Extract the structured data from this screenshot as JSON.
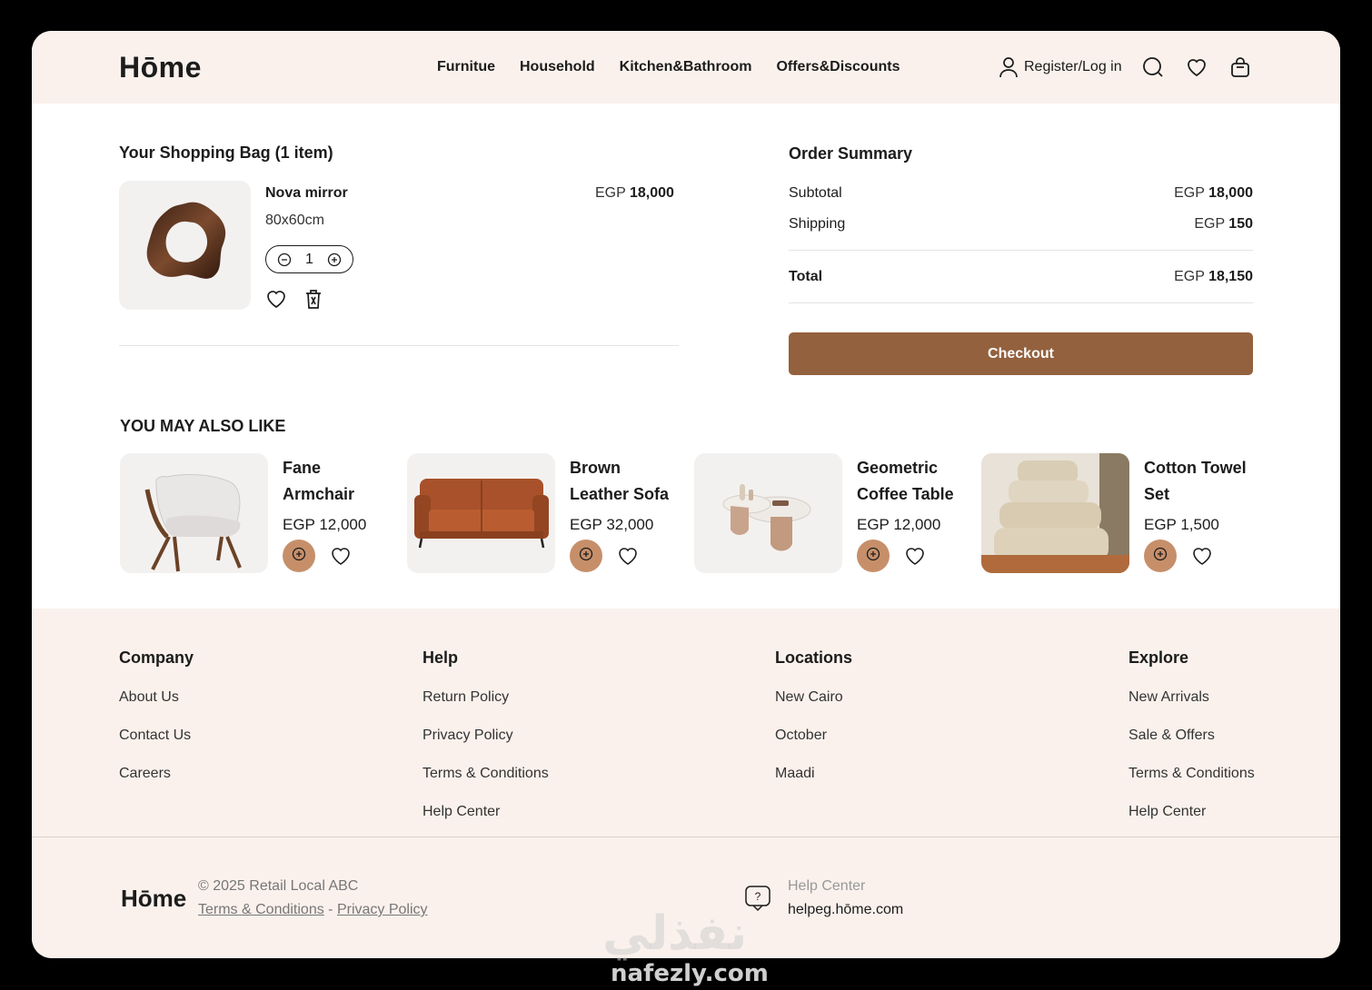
{
  "header": {
    "logo": "Hōme",
    "nav": [
      "Furnitue",
      "Household",
      "Kitchen&Bathroom",
      "Offers&Discounts"
    ],
    "register_label": "Register/Log in",
    "icons": [
      "user-icon",
      "search-icon",
      "heart-icon",
      "bag-icon"
    ]
  },
  "bag": {
    "title": "Your Shopping Bag (1 item)",
    "item": {
      "name": "Nova mirror",
      "size": "80x60cm",
      "currency": "EGP",
      "price": "18,000",
      "quantity": "1"
    }
  },
  "summary": {
    "title": "Order Summary",
    "subtotal_label": "Subtotal",
    "subtotal_currency": "EGP",
    "subtotal": "18,000",
    "shipping_label": "Shipping",
    "shipping_currency": "EGP",
    "shipping": "150",
    "total_label": "Total",
    "total_currency": "EGP",
    "total": "18,150",
    "checkout_label": "Checkout"
  },
  "also_like": {
    "title": "YOU MAY ALSO LIKE",
    "products": [
      {
        "name": "Fane Armchair",
        "price": "EGP 12,000"
      },
      {
        "name": "Brown Leather Sofa",
        "price": "EGP 32,000"
      },
      {
        "name": "Geometric Coffee Table",
        "price": "EGP 12,000"
      },
      {
        "name": "Cotton Towel Set",
        "price": "EGP 1,500"
      }
    ]
  },
  "footer": {
    "columns": [
      {
        "title": "Company",
        "links": [
          "About Us",
          "Contact Us",
          "Careers"
        ]
      },
      {
        "title": "Help",
        "links": [
          "Return Policy",
          "Privacy Policy",
          "Terms & Conditions",
          "Help Center"
        ]
      },
      {
        "title": "Locations",
        "links": [
          "New Cairo",
          "October",
          "Maadi"
        ]
      },
      {
        "title": "Explore",
        "links": [
          "New Arrivals",
          "Sale & Offers",
          "Terms & Conditions",
          "Help Center"
        ]
      }
    ],
    "logo": "Hōme",
    "copyright": "© 2025 Retail Local ABC",
    "terms_link": "Terms & Conditions",
    "separator": "-",
    "privacy_link": "Privacy Policy",
    "help_label": "Help Center",
    "help_email": "helpeg.hōme.com"
  },
  "watermark": {
    "arabic": "نفذلي",
    "domain": "nafezly.com"
  },
  "colors": {
    "accent": "#93613e",
    "add_button": "#c68f6a",
    "header_bg": "#faf1ec",
    "page_bg": "#000000"
  }
}
